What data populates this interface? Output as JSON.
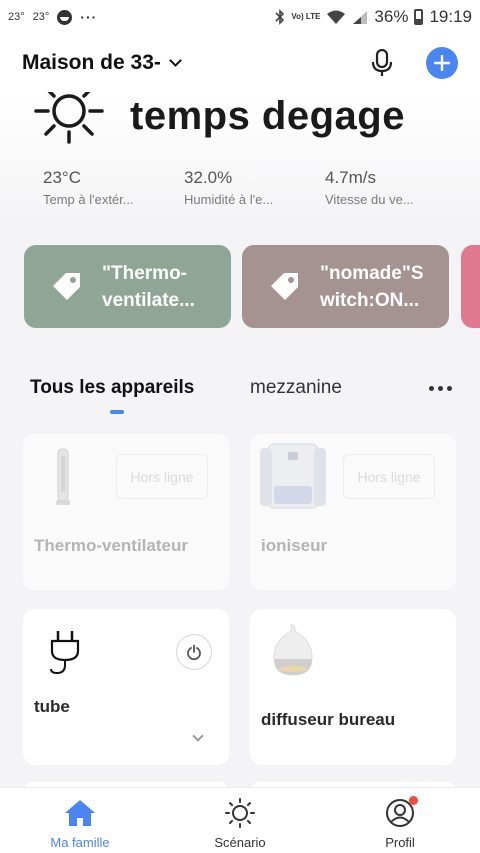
{
  "status_bar": {
    "notif_temp_1": "23°",
    "notif_temp_2": "23°",
    "network": "Vo) LTE",
    "battery": "36%",
    "time": "19:19"
  },
  "header": {
    "home_name": "Maison de 33-"
  },
  "weather": {
    "condition": "temps degage",
    "icon": "sun-icon",
    "metrics": [
      {
        "value": "23°C",
        "label": "Temp à l'extér..."
      },
      {
        "value": "32.0%",
        "label": "Humidité à l'e..."
      },
      {
        "value": "4.7m/s",
        "label": "Vitesse du ve..."
      }
    ]
  },
  "scenes": [
    {
      "line1": "\"Thermo-",
      "line2": "ventilate...",
      "color": "#8fa596"
    },
    {
      "line1": "\"nomade\"S",
      "line2": "witch:ON...",
      "color": "#a59392"
    },
    {
      "line1": "",
      "line2": "",
      "color": "#e07a92"
    }
  ],
  "tabs": {
    "all": "Tous les appareils",
    "mezzanine": "mezzanine"
  },
  "devices": [
    {
      "name": "Thermo-ventilateur",
      "status": "Hors ligne"
    },
    {
      "name": "ioniseur",
      "status": "Hors ligne"
    },
    {
      "name": "tube",
      "status": ""
    },
    {
      "name": "diffuseur bureau",
      "status": ""
    }
  ],
  "bottom_nav": [
    {
      "label": "Ma famille",
      "icon": "home-icon"
    },
    {
      "label": "Scénario",
      "icon": "scenario-sun-icon"
    },
    {
      "label": "Profil",
      "icon": "profile-icon"
    }
  ],
  "colors": {
    "accent": "#4a86f0",
    "background": "#f4f4f6",
    "notification": "#f04a3a"
  }
}
